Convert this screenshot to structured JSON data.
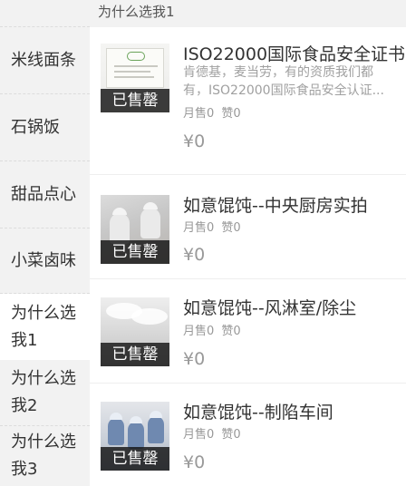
{
  "sidebar": {
    "categories": [
      {
        "label": "米线面条"
      },
      {
        "label": "石锅饭"
      },
      {
        "label": "甜品点心"
      },
      {
        "label": "小菜卤味"
      },
      {
        "label": "为什么选我1",
        "active": true
      },
      {
        "label": "为什么选我2"
      },
      {
        "label": "为什么选我3"
      }
    ]
  },
  "section": {
    "title": "为什么选我1"
  },
  "products": [
    {
      "name": "ISO22000国际食品安全证书",
      "desc_line1": "肯德基，麦当劳，有的资质我们都",
      "desc_line2": "有，ISO22000国际食品安全认证...",
      "monthly_sales": "月售0",
      "likes": "赞0",
      "price": "¥0",
      "badge": "已售罄",
      "image": "certificate-photo"
    },
    {
      "name": "如意馄饨--中央厨房实拍",
      "monthly_sales": "月售0",
      "likes": "赞0",
      "price": "¥0",
      "badge": "已售罄",
      "image": "kitchen-photo"
    },
    {
      "name": "如意馄饨--风淋室/除尘",
      "monthly_sales": "月售0",
      "likes": "赞0",
      "price": "¥0",
      "badge": "已售罄",
      "image": "air-shower-room-photo"
    },
    {
      "name": "如意馄饨--制陷车间",
      "monthly_sales": "月售0",
      "likes": "赞0",
      "price": "¥0",
      "badge": "已售罄",
      "image": "workshop-photo"
    }
  ]
}
